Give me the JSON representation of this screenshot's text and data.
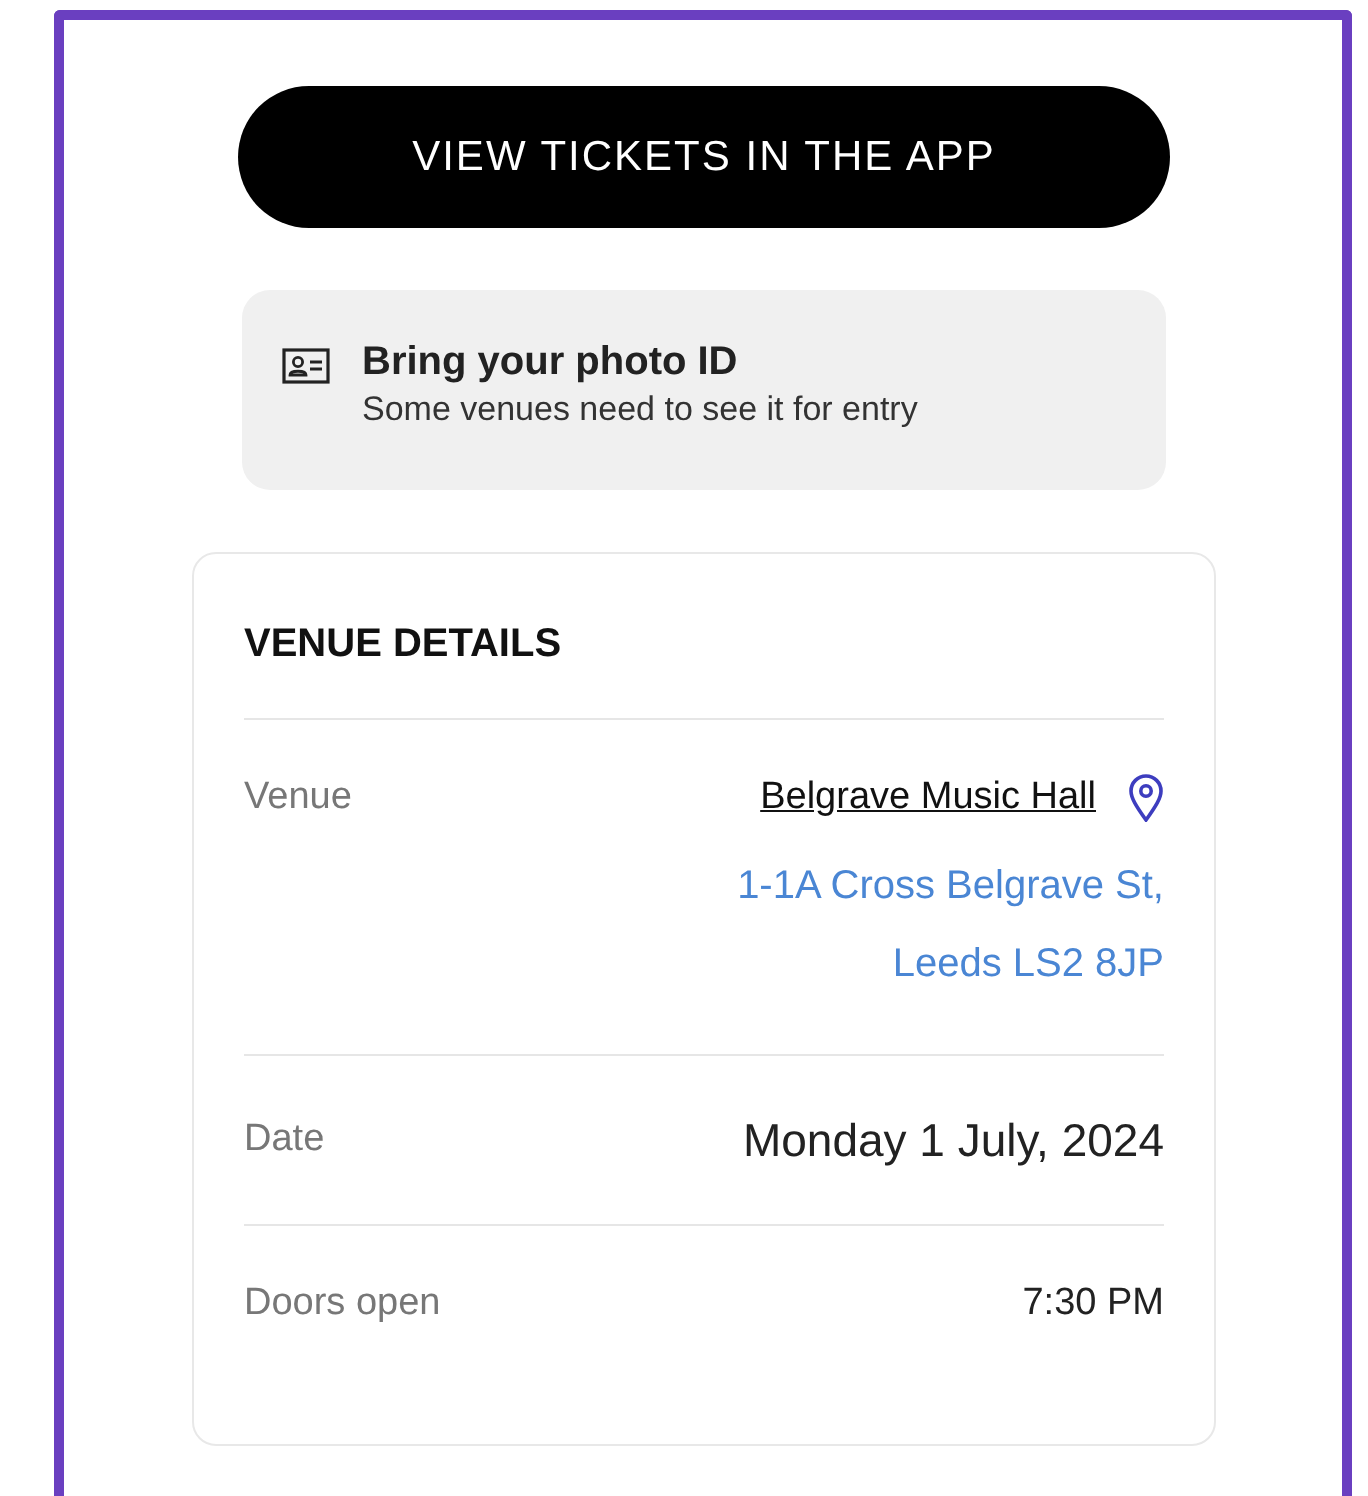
{
  "primary_button": {
    "label": "VIEW TICKETS IN THE APP"
  },
  "notice": {
    "title": "Bring your photo ID",
    "text": "Some venues need to see it for entry"
  },
  "venue_details": {
    "title": "VENUE DETAILS",
    "rows": [
      {
        "kind": "venue",
        "label": "Venue",
        "name": "Belgrave Music Hall",
        "address": [
          "1-1A Cross Belgrave St,",
          "Leeds LS2 8JP"
        ]
      },
      {
        "kind": "plain",
        "label": "Date",
        "value": "Monday 1 July, 2024",
        "emphasis": true
      },
      {
        "kind": "plain",
        "label": "Doors open",
        "value": "7:30 PM",
        "emphasis": false
      }
    ]
  }
}
